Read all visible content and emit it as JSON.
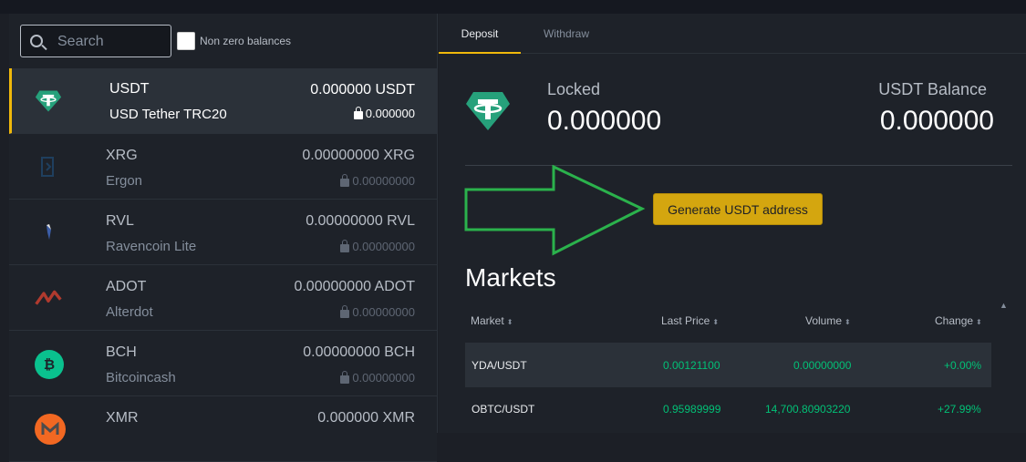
{
  "search": {
    "placeholder": "Search"
  },
  "filter": {
    "non_zero_label": "Non zero balances"
  },
  "coins": [
    {
      "symbol": "USDT",
      "name": "USD Tether TRC20",
      "balance": "0.000000 USDT",
      "locked": "0.000000",
      "icon": "tether-icon",
      "color": "#26a17b"
    },
    {
      "symbol": "XRG",
      "name": "Ergon",
      "balance": "0.00000000 XRG",
      "locked": "0.00000000",
      "icon": "ergon-icon",
      "color": "#2d5f8a"
    },
    {
      "symbol": "RVL",
      "name": "Ravencoin Lite",
      "balance": "0.00000000 RVL",
      "locked": "0.00000000",
      "icon": "raven-icon",
      "color": "#3c5ea8"
    },
    {
      "symbol": "ADOT",
      "name": "Alterdot",
      "balance": "0.00000000 ADOT",
      "locked": "0.00000000",
      "icon": "alterdot-icon",
      "color": "#c0392b"
    },
    {
      "symbol": "BCH",
      "name": "Bitcoincash",
      "balance": "0.00000000 BCH",
      "locked": "0.00000000",
      "icon": "bitcoincash-icon",
      "color": "#0ac18e"
    },
    {
      "symbol": "XMR",
      "name": "",
      "balance": "0.000000 XMR",
      "locked": "",
      "icon": "monero-icon",
      "color": "#f26822"
    }
  ],
  "tabs": {
    "deposit": "Deposit",
    "withdraw": "Withdraw"
  },
  "wallet": {
    "locked_label": "Locked",
    "locked_value": "0.000000",
    "balance_label": "USDT Balance",
    "balance_value": "0.000000"
  },
  "generate_button": "Generate USDT address",
  "markets": {
    "title": "Markets",
    "headers": {
      "market": "Market",
      "last_price": "Last Price",
      "volume": "Volume",
      "change": "Change"
    },
    "rows": [
      {
        "pair": "YDA/USDT",
        "last_price": "0.00121100",
        "volume": "0.00000000",
        "change": "+0.00%"
      },
      {
        "pair": "OBTC/USDT",
        "last_price": "0.95989999",
        "volume": "14,700.80903220",
        "change": "+27.99%"
      }
    ]
  },
  "colors": {
    "accent": "#f0b90b",
    "positive": "#02c076",
    "annotation_arrow": "#2bb24c"
  }
}
